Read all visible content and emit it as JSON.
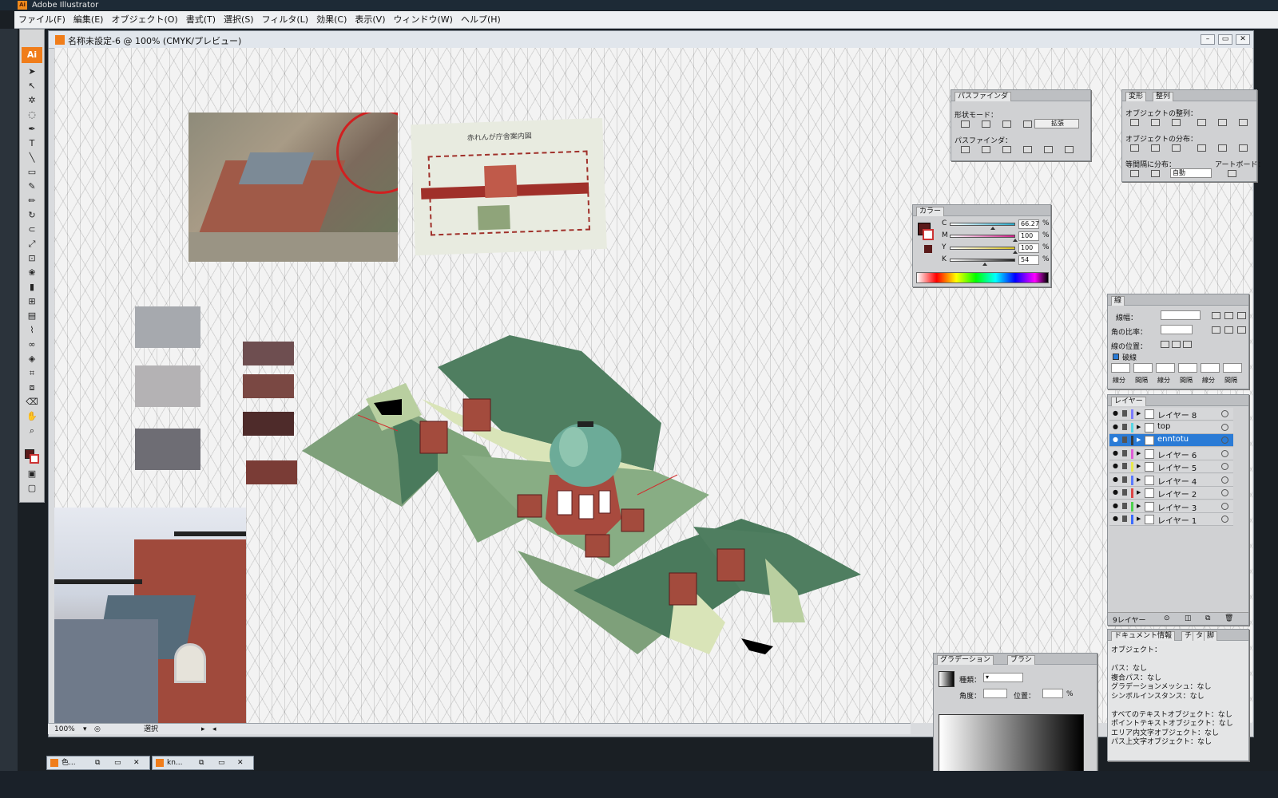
{
  "app": {
    "title": "Adobe Illustrator",
    "logo": "Ai"
  },
  "menu": [
    "ファイル(F)",
    "編集(E)",
    "オブジェクト(O)",
    "書式(T)",
    "選択(S)",
    "フィルタ(L)",
    "効果(C)",
    "表示(V)",
    "ウィンドウ(W)",
    "ヘルプ(H)"
  ],
  "document": {
    "title": "名称未設定-6 @ 100% (CMYK/プレビュー)"
  },
  "status": {
    "zoom": "100%",
    "tool": "選択"
  },
  "taskbar": {
    "item1": "色...",
    "item2": "kn..."
  },
  "pathfinder": {
    "tab": "パスファインダ",
    "shape_modes": "形状モード：",
    "expand_label": "拡張",
    "pathfinders": "パスファインダ："
  },
  "align": {
    "tab1": "変形",
    "tab2": "整列",
    "align_objects": "オブジェクトの整列：",
    "distribute_objects": "オブジェクトの分布：",
    "distribute_spacing": "等間隔に分布：",
    "artboard": "アートボード：",
    "auto": "自動"
  },
  "color": {
    "tab": "カラー",
    "channels": [
      {
        "name": "C",
        "value": "66.27",
        "color": "#2aa9c9",
        "fill": 0.66
      },
      {
        "name": "M",
        "value": "100",
        "color": "#d0208a",
        "fill": 1.0
      },
      {
        "name": "Y",
        "value": "100",
        "color": "#d9c21e",
        "fill": 1.0
      },
      {
        "name": "K",
        "value": "54",
        "color": "#222222",
        "fill": 0.54
      }
    ],
    "unit": "%",
    "fill_color": "#5a1a1a"
  },
  "stroke": {
    "tab": "線",
    "weight_label": "線幅：",
    "miter_label": "角の比率：",
    "align_label": "線の位置：",
    "dashed_label": "破線",
    "dash_labels": [
      "線分",
      "間隔",
      "線分",
      "間隔",
      "線分",
      "間隔"
    ]
  },
  "layers": {
    "tab": "レイヤー",
    "count": "9レイヤー",
    "rows": [
      {
        "name": "レイヤー 8",
        "color": "#7a7aff",
        "selected": false
      },
      {
        "name": "top",
        "color": "#55d6e6",
        "selected": false
      },
      {
        "name": "enntotu",
        "color": "#3a3a3a",
        "selected": true
      },
      {
        "name": "レイヤー 6",
        "color": "#e05ad6",
        "selected": false
      },
      {
        "name": "レイヤー 5",
        "color": "#e8e84a",
        "selected": false
      },
      {
        "name": "レイヤー 4",
        "color": "#5a7aff",
        "selected": false
      },
      {
        "name": "レイヤー 2",
        "color": "#dd4444",
        "selected": false
      },
      {
        "name": "レイヤー 3",
        "color": "#4ad04a",
        "selected": false
      },
      {
        "name": "レイヤー 1",
        "color": "#3a6aff",
        "selected": false
      }
    ]
  },
  "docinfo": {
    "tab": "ドキュメント情報",
    "tab2": "チ",
    "tab3": "タ",
    "tab4": "脚",
    "lines": [
      "オブジェクト：",
      "",
      "パス：なし",
      "複合パス：なし",
      "グラデーションメッシュ：なし",
      "シンボルインスタンス：なし",
      "",
      "すべてのテキストオブジェクト：なし",
      "ポイントテキストオブジェクト：なし",
      "エリア内文字オブジェクト：なし",
      "パス上文字オブジェクト：なし"
    ]
  },
  "gradient": {
    "tab1": "グラデーション",
    "tab2": "ブラシ",
    "type_label": "種類：",
    "angle_label": "角度：",
    "position_label": "位置：",
    "unit": "%"
  },
  "swatches": {
    "grays": [
      "#a6a9ae",
      "#b4b2b4",
      "#6e6d74"
    ],
    "browns": [
      "#6e4e50",
      "#7a4843",
      "#4e2b2a",
      "#7a3c36"
    ]
  },
  "map_caption": "赤れんが庁舎案内図"
}
